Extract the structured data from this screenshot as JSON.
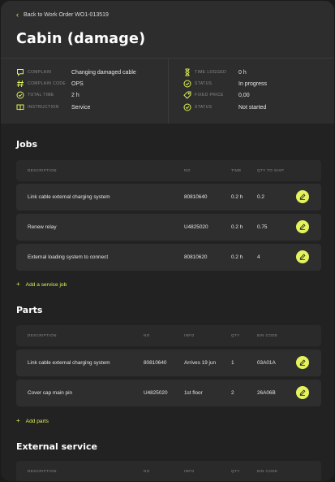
{
  "back_link": {
    "label": "Back to Work Order WO1-013519",
    "icon": "chevron-left-icon"
  },
  "page_title": "Cabin (damage)",
  "info_left": [
    {
      "icon": "message-icon",
      "label": "COMPLAIN",
      "value": "Changing damaged cable"
    },
    {
      "icon": "hash-icon",
      "label": "COMPLAIN CODE",
      "value": "OPS"
    },
    {
      "icon": "clock-icon",
      "label": "TOTAL TIME",
      "value": "2 h"
    },
    {
      "icon": "book-icon",
      "label": "INSTRUCTION",
      "value": "Service"
    }
  ],
  "info_right": [
    {
      "icon": "hourglass-icon",
      "label": "TIME LOGGED",
      "value": "0 h"
    },
    {
      "icon": "check-circle-icon",
      "label": "STATUS",
      "value": "In progress"
    },
    {
      "icon": "tag-icon",
      "label": "FIXED PRICE",
      "value": "0,00"
    },
    {
      "icon": "check-circle-icon",
      "label": "STATUS",
      "value": "Not started"
    }
  ],
  "jobs": {
    "title": "Jobs",
    "headers": {
      "description": "DESCRIPTION",
      "no": "NO",
      "time": "TIME",
      "qty": "QTY TO SHIP"
    },
    "rows": [
      {
        "description": "Link cable external charging system",
        "no": "80810640",
        "time": "0.2 h",
        "qty": "0.2"
      },
      {
        "description": "Renew relay",
        "no": "U4825020",
        "time": "0.2 h",
        "qty": "0.75"
      },
      {
        "description": "External loading system to connect",
        "no": "80810620",
        "time": "0.2 h",
        "qty": "4"
      }
    ],
    "add_label": "Add a service job"
  },
  "parts": {
    "title": "Parts",
    "headers": {
      "description": "DESCRIPTION",
      "no": "NO",
      "info": "INFO",
      "qty": "QTY",
      "bin": "BIN CODE"
    },
    "rows": [
      {
        "description": "Link cable external charging system",
        "no": "80810640",
        "info": "Arrives 19 jun",
        "qty": "1",
        "bin": "03A01A"
      },
      {
        "description": "Cover cap main pin",
        "no": "U4825020",
        "info": "1st floor",
        "qty": "2",
        "bin": "26A06B"
      }
    ],
    "add_label": "Add parts"
  },
  "external": {
    "title": "External service",
    "headers": {
      "description": "DESCRIPTION",
      "no": "NO",
      "info": "INFO",
      "qty": "QTY",
      "bin": "BIN CODE"
    }
  },
  "colors": {
    "accent": "#dff058",
    "background": "#222222",
    "header": "#2d2d2d",
    "row": "#2e2e2e"
  }
}
